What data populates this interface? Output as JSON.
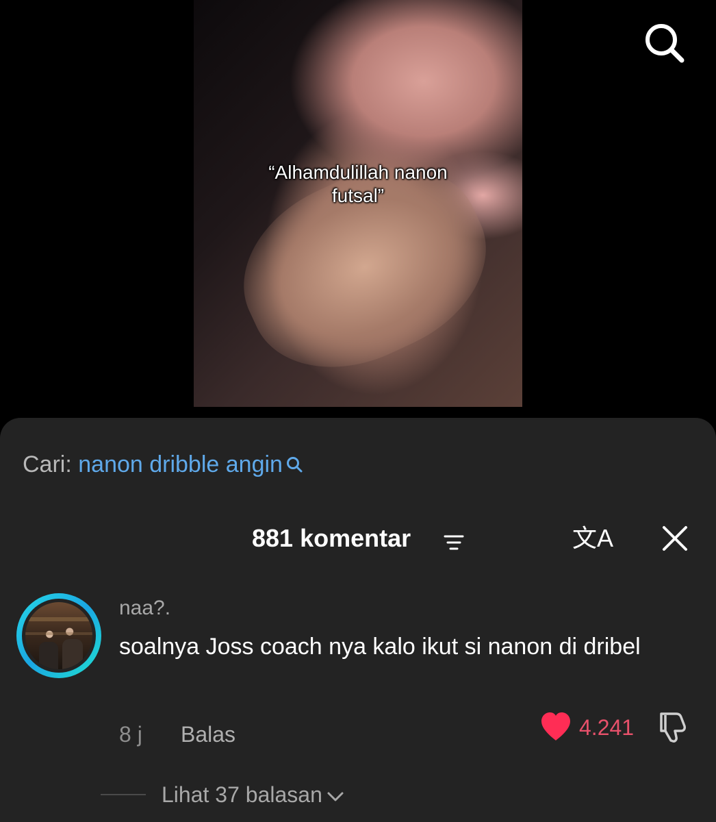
{
  "video": {
    "caption_line1": "“Alhamdulillah nanon",
    "caption_line2": "futsal”"
  },
  "search_suggestion": {
    "prefix": "Cari:",
    "query": "nanon dribble angin"
  },
  "comments_header": {
    "count_label": "881 komentar"
  },
  "comment": {
    "username": "naa?.",
    "text": "soalnya Joss coach nya kalo ikut si nanon di dribel",
    "time": "8 j",
    "reply_label": "Balas",
    "likes": "4.241",
    "view_replies_label": "Lihat 37 balasan"
  },
  "colors": {
    "sheet_bg": "#232323",
    "link_blue": "#5fa9ea",
    "like_red": "#ff2d55",
    "avatar_ring": "#1aa6e3"
  },
  "icons": {
    "top_search": "search-icon",
    "suggestion": "search-icon",
    "sort": "sort-filter-icon",
    "translate": "translate-icon",
    "close": "close-icon",
    "like": "heart-icon",
    "dislike": "thumbs-down-icon",
    "expand": "chevron-down-icon"
  }
}
